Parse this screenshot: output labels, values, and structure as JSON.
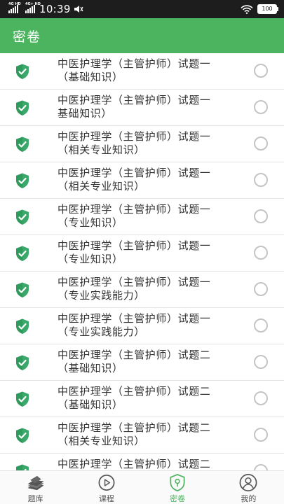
{
  "status_bar": {
    "signal1": "4G HD",
    "signal2": "4G+ HD",
    "time": "10:39",
    "battery": "100"
  },
  "header": {
    "title": "密卷"
  },
  "papers": [
    {
      "line1": "中医护理学（主管护师）试题一",
      "line2": "（基础知识）"
    },
    {
      "line1": "中医护理学（主管护师）试题一",
      "line2": "基础知识）"
    },
    {
      "line1": "中医护理学（主管护师）试题一",
      "line2": "（相关专业知识）"
    },
    {
      "line1": "中医护理学（主管护师）试题一",
      "line2": "（相关专业知识）"
    },
    {
      "line1": "中医护理学（主管护师）试题一",
      "line2": "（专业知识）"
    },
    {
      "line1": "中医护理学（主管护师）试题一",
      "line2": "（专业知识）"
    },
    {
      "line1": "中医护理学（主管护师）试题一",
      "line2": "（专业实践能力）"
    },
    {
      "line1": "中医护理学（主管护师）试题一",
      "line2": "（专业实践能力）"
    },
    {
      "line1": "中医护理学（主管护师）试题二",
      "line2": "（基础知识）"
    },
    {
      "line1": "中医护理学（主管护师）试题二",
      "line2": "（基础知识）"
    },
    {
      "line1": "中医护理学（主管护师）试题二",
      "line2": "（相关专业知识）"
    },
    {
      "line1": "中医护理学（主管护师）试题二",
      "line2": ""
    }
  ],
  "bottom_nav": [
    {
      "label": "题库",
      "icon": "books-icon"
    },
    {
      "label": "课程",
      "icon": "play-circle-icon"
    },
    {
      "label": "密卷",
      "icon": "lock-shield-icon",
      "active": true
    },
    {
      "label": "我的",
      "icon": "user-icon"
    }
  ],
  "colors": {
    "accent": "#4cb35f",
    "status_bar": "#1d1d1d"
  }
}
